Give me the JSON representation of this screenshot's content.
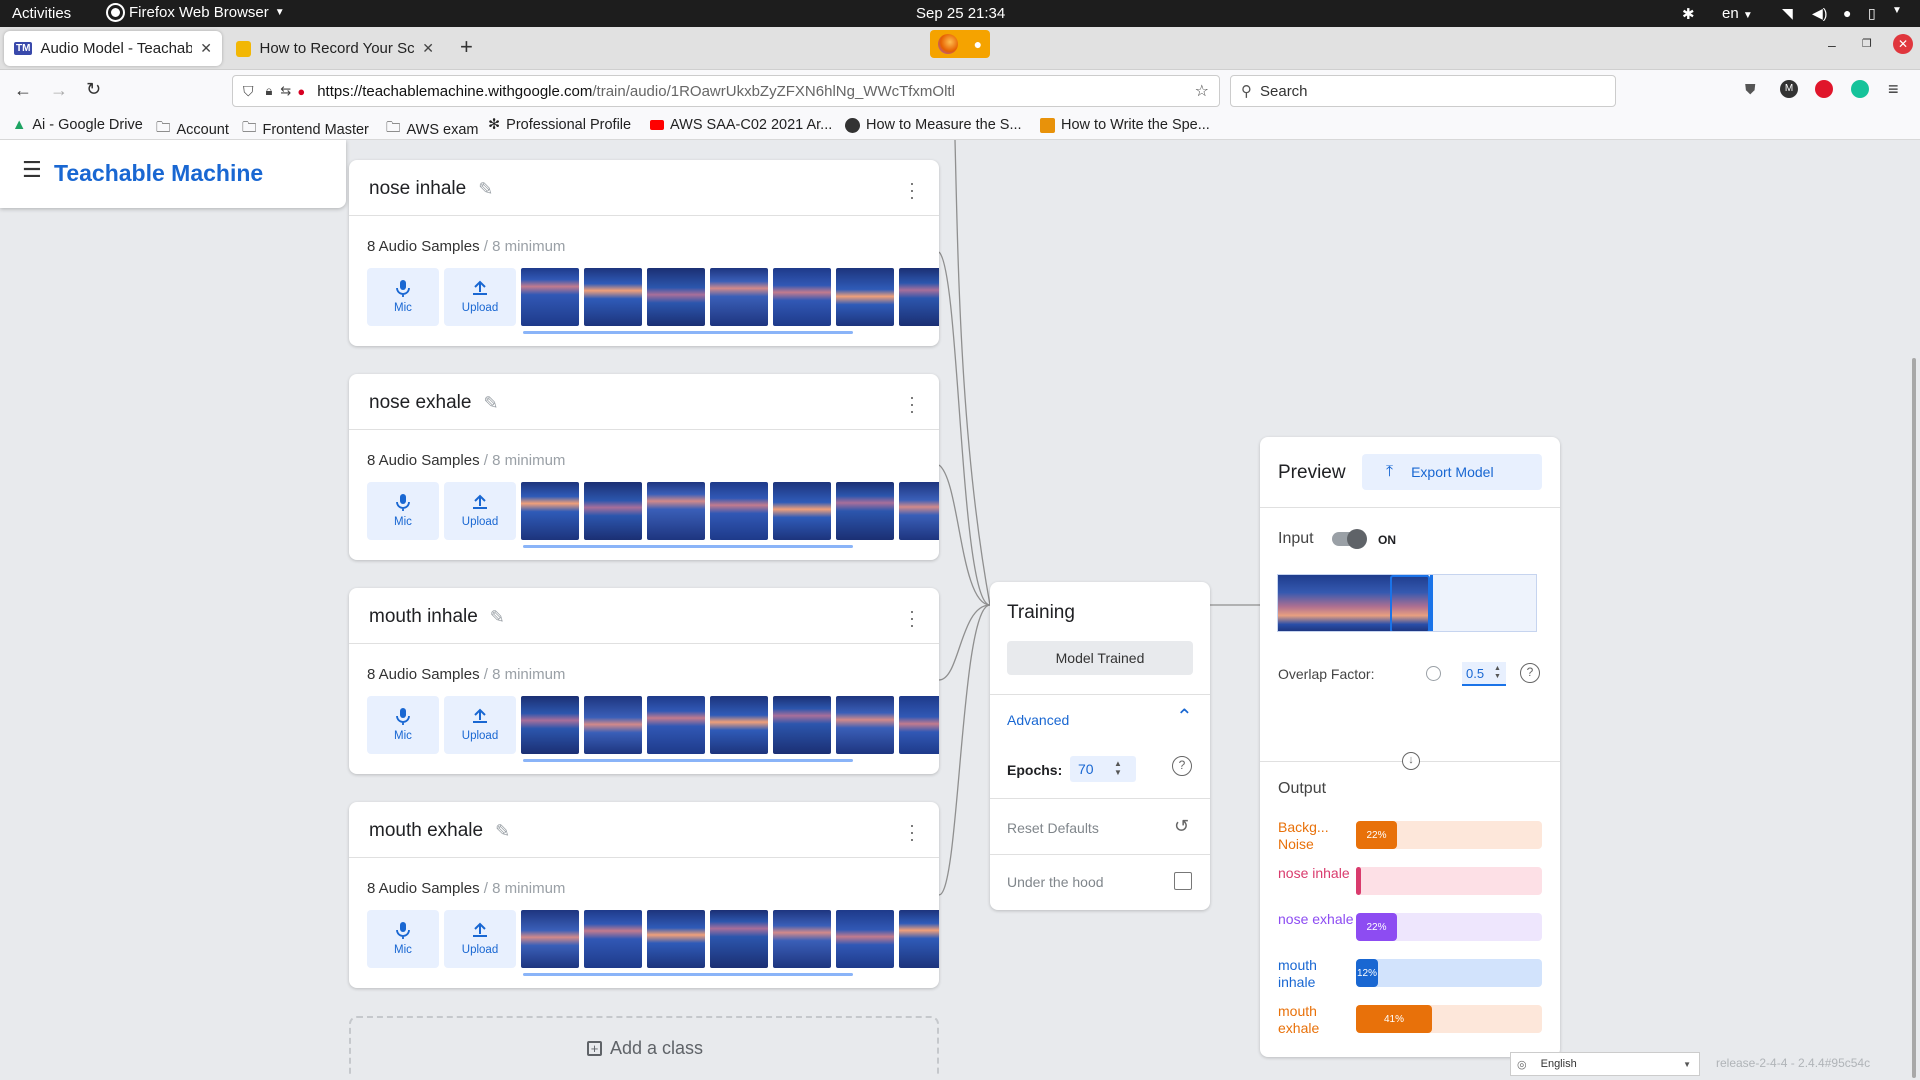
{
  "system": {
    "activities": "Activities",
    "app": "Firefox Web Browser",
    "datetime": "Sep 25  21:34",
    "lang": "en"
  },
  "tabs": [
    {
      "label": "Audio Model - Teachable",
      "favicon": "TM"
    },
    {
      "label": "How to Record Your Scre",
      "favicon": ""
    }
  ],
  "url": {
    "host": "https://teachablemachine.withgoogle.com",
    "path": "/train/audio/1ROawrUkxbZyZFXN6hlNg_WWcTfxmOltl"
  },
  "search_placeholder": "Search",
  "bookmarks": [
    "Ai - Google Drive",
    "Account",
    "Frontend Master",
    "AWS exam",
    "Professional Profile",
    "AWS SAA-C02 2021 Ar...",
    "How to Measure the S...",
    "How to Write the Spe..."
  ],
  "app_title": "Teachable Machine",
  "classes": [
    {
      "name": "nose inhale",
      "count": "8 Audio Samples",
      "min": " / 8 minimum"
    },
    {
      "name": "nose exhale",
      "count": "8 Audio Samples",
      "min": " / 8 minimum"
    },
    {
      "name": "mouth inhale",
      "count": "8 Audio Samples",
      "min": " / 8 minimum"
    },
    {
      "name": "mouth exhale",
      "count": "8 Audio Samples",
      "min": " / 8 minimum"
    }
  ],
  "sample_buttons": {
    "mic": "Mic",
    "upload": "Upload"
  },
  "add_class": "Add a class",
  "training": {
    "title": "Training",
    "status_button": "Model Trained",
    "advanced": "Advanced",
    "epochs_label": "Epochs:",
    "epochs_value": "70",
    "reset": "Reset Defaults",
    "under_hood": "Under the hood"
  },
  "preview": {
    "title": "Preview",
    "export": "Export Model",
    "input_label": "Input",
    "toggle_state": "ON",
    "overlap_label": "Overlap Factor:",
    "overlap_value": "0.5",
    "output_title": "Output"
  },
  "outputs": [
    {
      "label": "Backg... Noise",
      "value": 0.22,
      "text": "22%",
      "color": "#e8710a",
      "track": "#fde7da"
    },
    {
      "label": "nose inhale",
      "value": 0.02,
      "text": "",
      "color": "#d93b6d",
      "track": "#fde0e6"
    },
    {
      "label": "nose exhale",
      "value": 0.22,
      "text": "22%",
      "color": "#8d4cf2",
      "track": "#eee6fd"
    },
    {
      "label": "mouth inhale",
      "value": 0.12,
      "text": "12%",
      "color": "#1967d2",
      "track": "#d2e3fc"
    },
    {
      "label": "mouth exhale",
      "value": 0.41,
      "text": "41%",
      "color": "#e8710a",
      "track": "#fde7da"
    }
  ],
  "footer": {
    "language": "English",
    "release": "release-2-4-4 - 2.4.4#95c54c"
  }
}
